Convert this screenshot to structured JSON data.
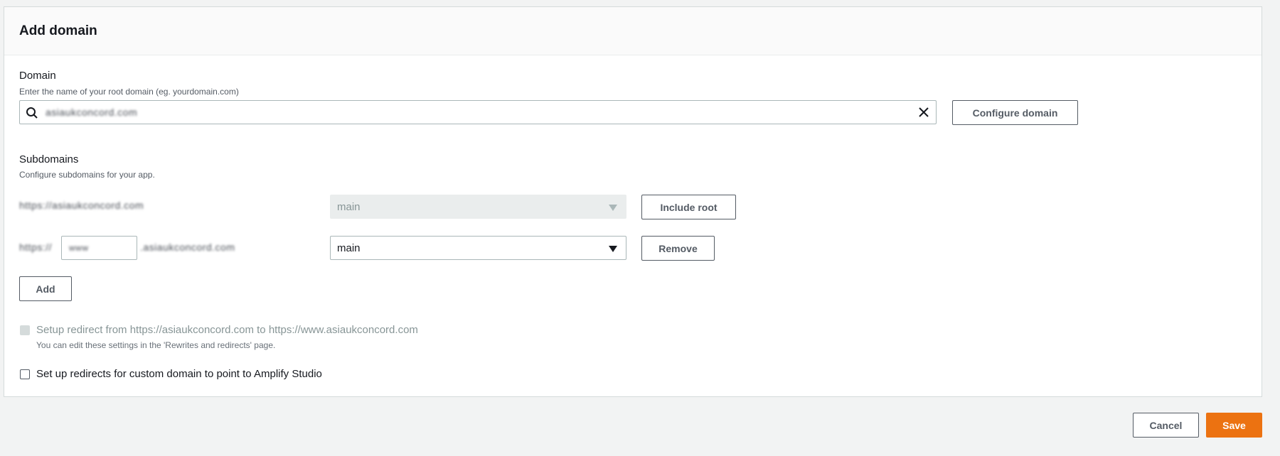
{
  "panel": {
    "title": "Add domain"
  },
  "domain": {
    "label": "Domain",
    "description": "Enter the name of your root domain (eg. yourdomain.com)",
    "value": "asiaukconcord.com",
    "configure_button": "Configure domain"
  },
  "subdomains": {
    "label": "Subdomains",
    "description": "Configure subdomains for your app.",
    "rows": [
      {
        "url_text": "https://asiaukconcord.com",
        "branch": "main",
        "action": "Include root"
      },
      {
        "url_prefix": "https://",
        "subdomain_value": "www",
        "url_suffix": ".asiaukconcord.com",
        "branch": "main",
        "action": "Remove"
      }
    ],
    "add_button": "Add"
  },
  "redirect": {
    "label": "Setup redirect from https://asiaukconcord.com to https://www.asiaukconcord.com",
    "hint": "You can edit these settings in the 'Rewrites and redirects' page."
  },
  "amplify": {
    "label": "Set up redirects for custom domain to point to Amplify Studio"
  },
  "footer": {
    "cancel": "Cancel",
    "save": "Save"
  },
  "colors": {
    "primary": "#ec7211",
    "background": "#f2f3f3"
  },
  "icons": {
    "search": "search-icon",
    "clear": "close-icon",
    "caret": "caret-down-icon"
  }
}
